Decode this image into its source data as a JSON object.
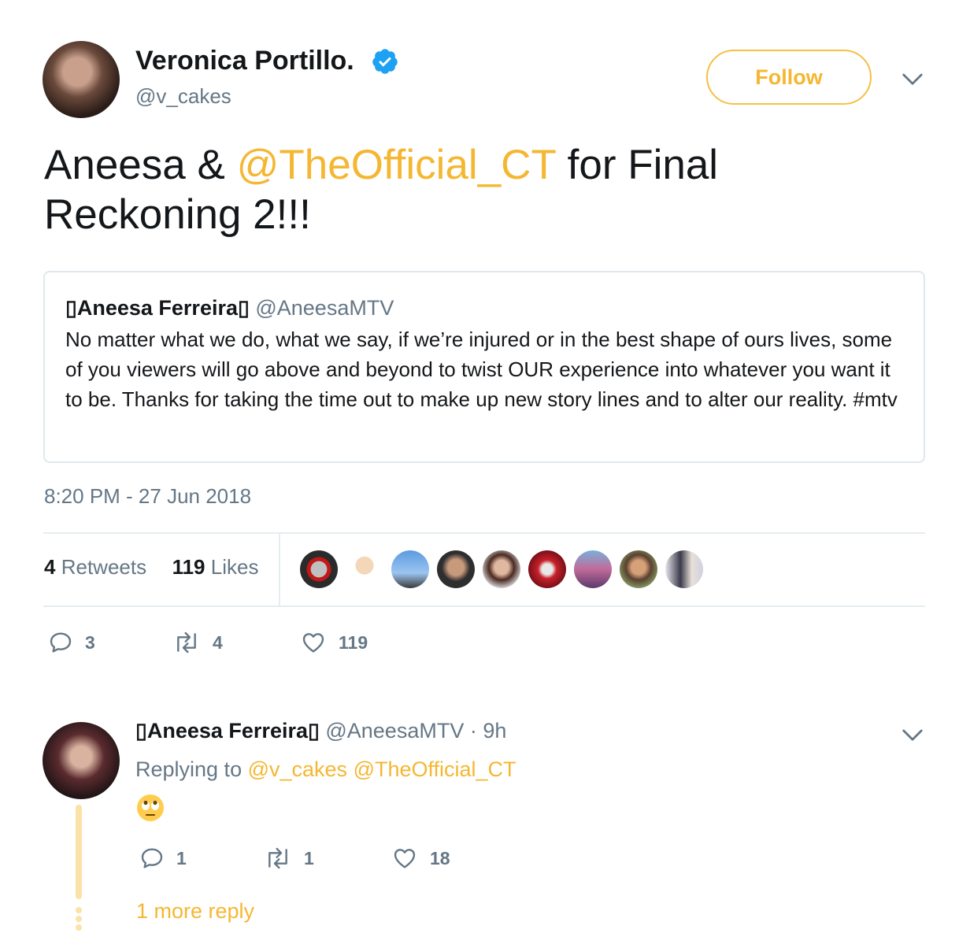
{
  "tweet": {
    "display_name": "Veronica Portillo.",
    "handle": "@v_cakes",
    "follow_label": "Follow",
    "text_before": "Aneesa & ",
    "mention": "@TheOfficial_CT",
    "text_after": " for Final Reckoning 2!!!",
    "timestamp": "8:20 PM - 27 Jun 2018",
    "retweets_count": "4",
    "retweets_label": "Retweets",
    "likes_count": "119",
    "likes_label": "Likes",
    "actions": {
      "replies": "3",
      "retweets": "4",
      "likes": "119"
    }
  },
  "quote": {
    "name": "▯Aneesa Ferreira▯",
    "handle": "@AneesaMTV",
    "text": "No matter what we do, what we say, if we’re injured or in the best shape of ours lives, some of you viewers will go above and beyond to twist OUR experience into whatever you want it to be. Thanks for taking the time out to make up new story lines and to alter our reality. #mtv"
  },
  "reply": {
    "name": "▯Aneesa Ferreira▯",
    "handle": "@AneesaMTV",
    "separator": " · ",
    "time": "9h",
    "replying_label": "Replying to ",
    "replying_to_1": "@v_cakes",
    "replying_to_2": "@TheOfficial_CT",
    "emoji_name": "rolling-eyes-emoji",
    "actions": {
      "replies": "1",
      "retweets": "1",
      "likes": "18"
    },
    "more_reply": "1 more reply"
  },
  "colors": {
    "accent": "#f5b731",
    "verified": "#1da1f2",
    "muted": "#657786",
    "text": "#14171a",
    "divider": "#e6ecf0"
  }
}
